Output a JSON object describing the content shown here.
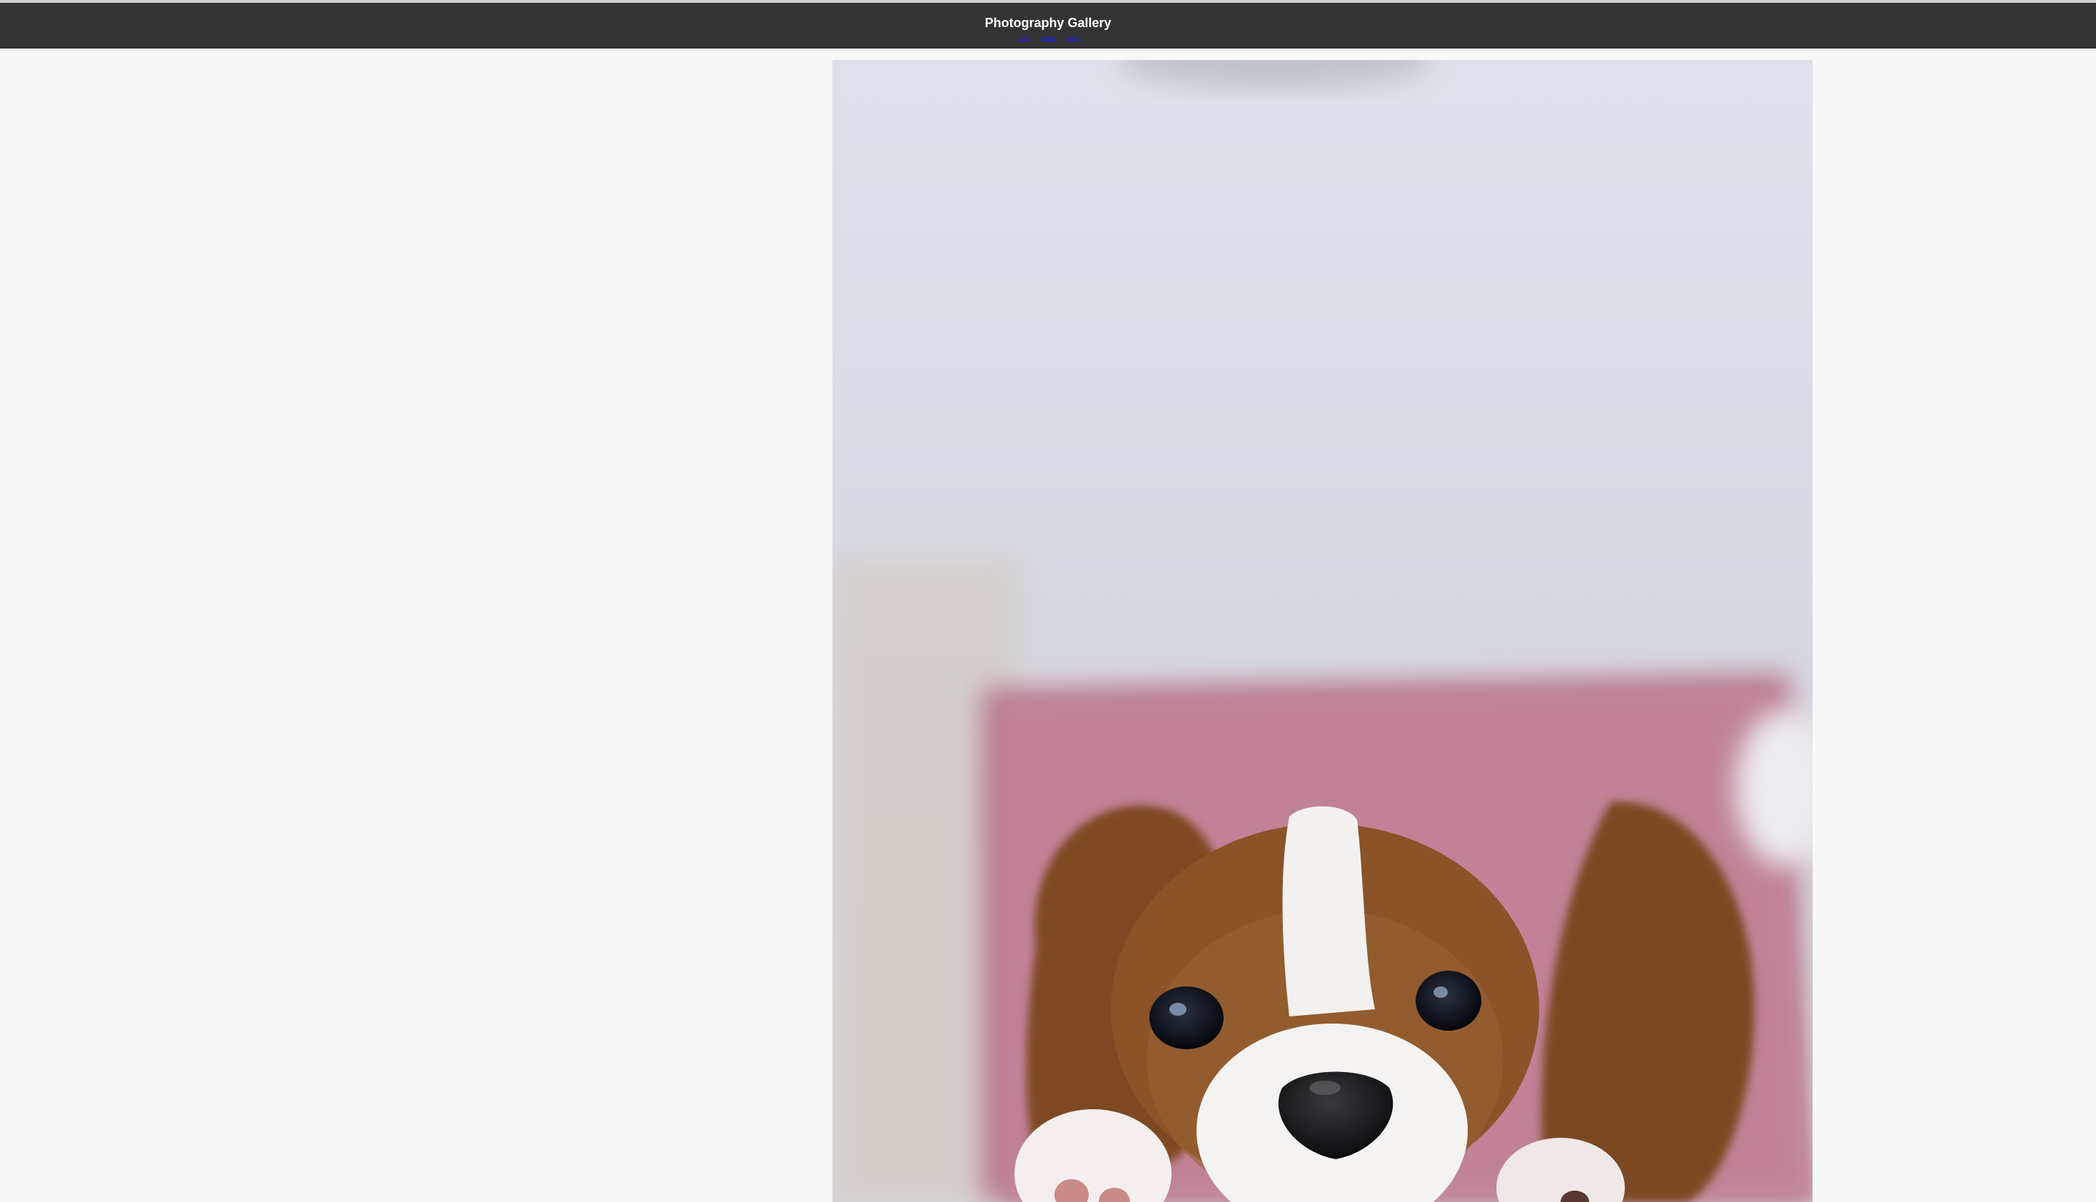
{
  "header": {
    "title": "Photography Gallery",
    "nav": [
      "Home",
      "Gallery",
      "About"
    ]
  },
  "colors": {
    "header_bg": "#333333",
    "page_bg": "#f8f8f8",
    "link": "#1a1aff"
  },
  "gallery": {
    "photo_subject": "puppy"
  }
}
